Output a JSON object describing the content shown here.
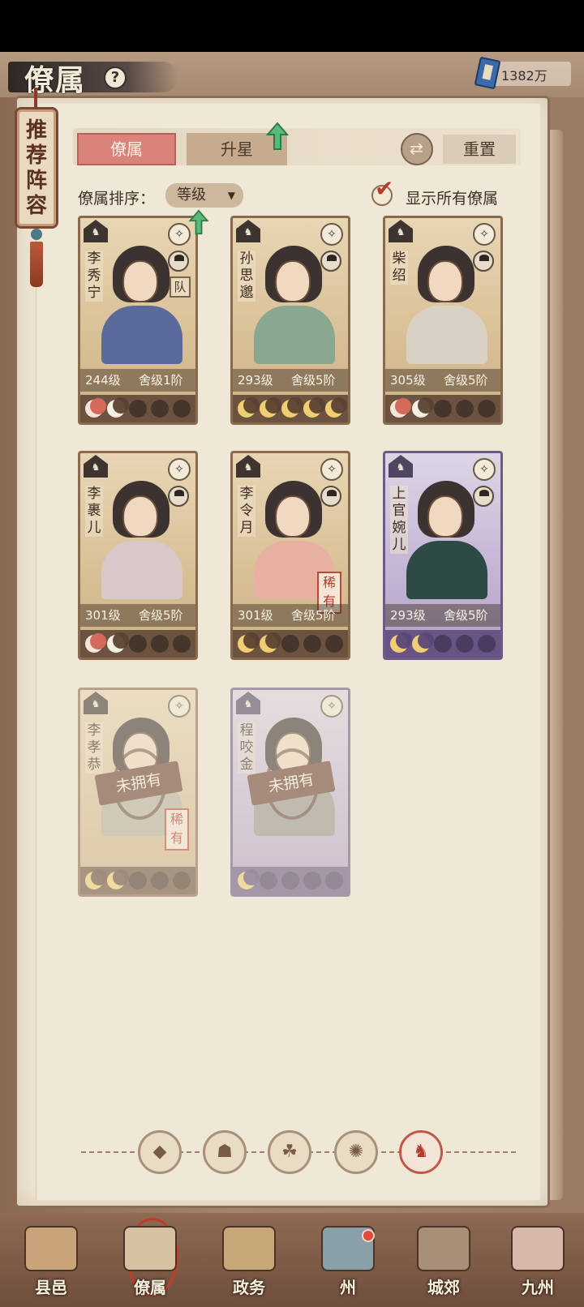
{
  "header": {
    "title": "僚属",
    "help": "?",
    "currency": "1382万"
  },
  "banner": {
    "label": "推荐阵容"
  },
  "tabs": [
    {
      "label": "僚属",
      "active": true
    },
    {
      "label": "升星",
      "active": false
    }
  ],
  "reset_label": "重置",
  "sort": {
    "label": "僚属排序：",
    "value": "等级"
  },
  "show_all": {
    "label": "显示所有僚属",
    "checked": true
  },
  "cards": [
    {
      "name": "李秀宁",
      "level": "244级",
      "home": "舍级1阶",
      "theme": "gold",
      "owned": true,
      "tag": "队",
      "rarity": "",
      "stars": [
        "red",
        "white",
        "empty",
        "empty",
        "empty"
      ],
      "upgrade": true
    },
    {
      "name": "孙思邈",
      "level": "293级",
      "home": "舍级5阶",
      "theme": "gold",
      "owned": true,
      "tag": "",
      "rarity": "",
      "stars": [
        "gold",
        "gold",
        "gold",
        "gold",
        "gold"
      ],
      "upgrade": false
    },
    {
      "name": "柴绍",
      "level": "305级",
      "home": "舍级5阶",
      "theme": "gold",
      "owned": true,
      "tag": "",
      "rarity": "",
      "stars": [
        "red",
        "white",
        "empty",
        "empty",
        "empty"
      ],
      "upgrade": false
    },
    {
      "name": "李裹儿",
      "level": "301级",
      "home": "舍级5阶",
      "theme": "gold",
      "owned": true,
      "tag": "",
      "rarity": "",
      "stars": [
        "red",
        "white",
        "empty",
        "empty",
        "empty"
      ],
      "upgrade": false
    },
    {
      "name": "李令月",
      "level": "301级",
      "home": "舍级5阶",
      "theme": "gold",
      "owned": true,
      "tag": "",
      "rarity": "稀有",
      "stars": [
        "gold",
        "gold",
        "empty",
        "empty",
        "empty"
      ],
      "upgrade": false
    },
    {
      "name": "上官婉儿",
      "level": "293级",
      "home": "舍级5阶",
      "theme": "purple",
      "owned": true,
      "tag": "",
      "rarity": "",
      "stars": [
        "gold",
        "gold",
        "empty",
        "empty",
        "empty"
      ],
      "upgrade": false
    },
    {
      "name": "李孝恭",
      "level": "",
      "home": "",
      "theme": "gold",
      "owned": false,
      "unowned_label": "未拥有",
      "tag": "",
      "rarity": "稀有",
      "stars": [
        "gold",
        "gold",
        "empty",
        "empty",
        "empty"
      ],
      "upgrade": false
    },
    {
      "name": "程咬金",
      "level": "",
      "home": "",
      "theme": "purple",
      "owned": false,
      "unowned_label": "未拥有",
      "tag": "",
      "rarity": "",
      "stars": [
        "gold",
        "empty",
        "empty",
        "empty",
        "empty"
      ],
      "upgrade": false
    }
  ],
  "filters": [
    {
      "icon": "diamond-icon",
      "glyph": "◆",
      "active": false
    },
    {
      "icon": "bell-icon",
      "glyph": "☗",
      "active": false
    },
    {
      "icon": "cat-icon",
      "glyph": "☘",
      "active": false
    },
    {
      "icon": "fan-icon",
      "glyph": "✺",
      "active": false
    },
    {
      "icon": "beast-icon",
      "glyph": "♞",
      "active": true
    }
  ],
  "bottom_nav": [
    {
      "label": "县邑",
      "active": false
    },
    {
      "label": "僚属",
      "active": true
    },
    {
      "label": "政务",
      "active": false
    },
    {
      "label": "州",
      "active": false
    },
    {
      "label": "城郊",
      "active": false
    },
    {
      "label": "九州",
      "active": false
    }
  ],
  "colors": {
    "accent_red": "#d9837b",
    "card_gold": "#d8bf95",
    "card_purple": "#c3b4d4",
    "upgrade_green": "#4aa86a"
  }
}
